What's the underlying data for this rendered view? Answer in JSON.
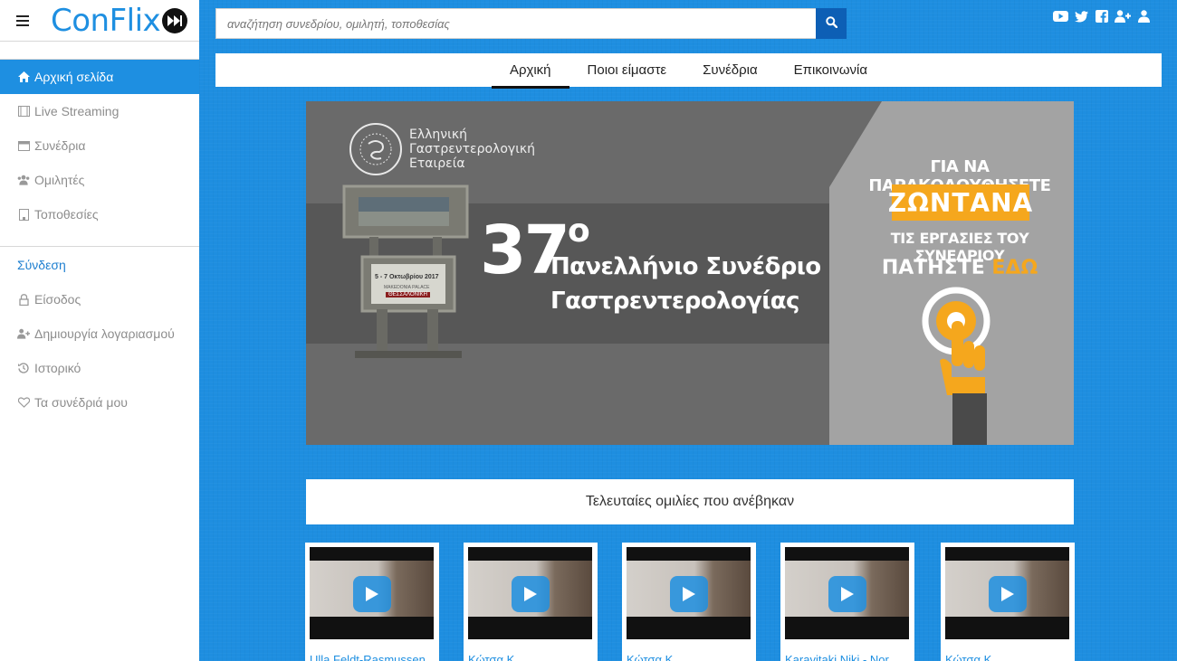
{
  "brand": {
    "logo_text": "ConFlix"
  },
  "search": {
    "placeholder": "αναζήτηση συνεδρίου, ομιλητή, τοποθεσίας"
  },
  "social": [
    "youtube-icon",
    "twitter-icon",
    "facebook-icon",
    "add-user-icon",
    "user-icon"
  ],
  "sidebar": {
    "items": [
      {
        "label": "Αρχική σελίδα",
        "icon": "home-icon",
        "active": true
      },
      {
        "label": "Live Streaming",
        "icon": "film-icon",
        "active": false
      },
      {
        "label": "Συνέδρια",
        "icon": "calendar-icon",
        "active": false
      },
      {
        "label": "Ομιλητές",
        "icon": "users-icon",
        "active": false
      },
      {
        "label": "Τοποθεσίες",
        "icon": "building-icon",
        "active": false
      }
    ],
    "account_heading": "Σύνδεση",
    "account_items": [
      {
        "label": "Είσοδος",
        "icon": "lock-icon"
      },
      {
        "label": "Δημιουργία λογαριασμού",
        "icon": "add-user-icon"
      },
      {
        "label": "Ιστορικό",
        "icon": "history-icon"
      },
      {
        "label": "Τα συνέδριά μου",
        "icon": "heart-icon"
      }
    ]
  },
  "tabs": [
    {
      "label": "Αρχική",
      "active": true
    },
    {
      "label": "Ποιοι είμαστε",
      "active": false
    },
    {
      "label": "Συνέδρια",
      "active": false
    },
    {
      "label": "Επικοινωνία",
      "active": false
    }
  ],
  "banner": {
    "org_line1": "Ελληνική",
    "org_line2": "Γαστρεντερολογική",
    "org_line3": "Εταιρεία",
    "number": "37",
    "superscript": "ο",
    "title_line1": "Πανελλήνιο Συνέδριο",
    "title_line2": "Γαστρεντερολογίας",
    "sign_dates": "5 - 7 Οκτωβρίου 2017",
    "sign_venue": "MAKEDONIA PALACE",
    "sign_city": "ΘΕΣΣΑΛΟΝΙΚΗ",
    "cta_line1": "ΓΙΑ ΝΑ ΠΑΡΑΚΟΛΟΥΘΗΣΕΤΕ",
    "cta_live": "ΖΩΝΤΑΝΑ",
    "cta_line2": "ΤΙΣ ΕΡΓΑΣΙΕΣ ΤΟΥ ΣΥΝΕΔΡΙΟΥ",
    "cta_press": "ΠΑΤΗΣΤΕ",
    "cta_here": "ΕΔΩ"
  },
  "latest": {
    "heading": "Τελευταίες ομιλίες που ανέβηκαν",
    "videos": [
      {
        "caption": "Ulla Feldt-Rasmussen"
      },
      {
        "caption": "Κώτσα Κ."
      },
      {
        "caption": "Κώτσα Κ."
      },
      {
        "caption": "Karavitaki Niki - Nor"
      },
      {
        "caption": "Κώτσα Κ."
      }
    ]
  },
  "colors": {
    "accent": "#1e8fe1",
    "search_button": "#0d5fb5",
    "cta_orange": "#f5a71d"
  }
}
